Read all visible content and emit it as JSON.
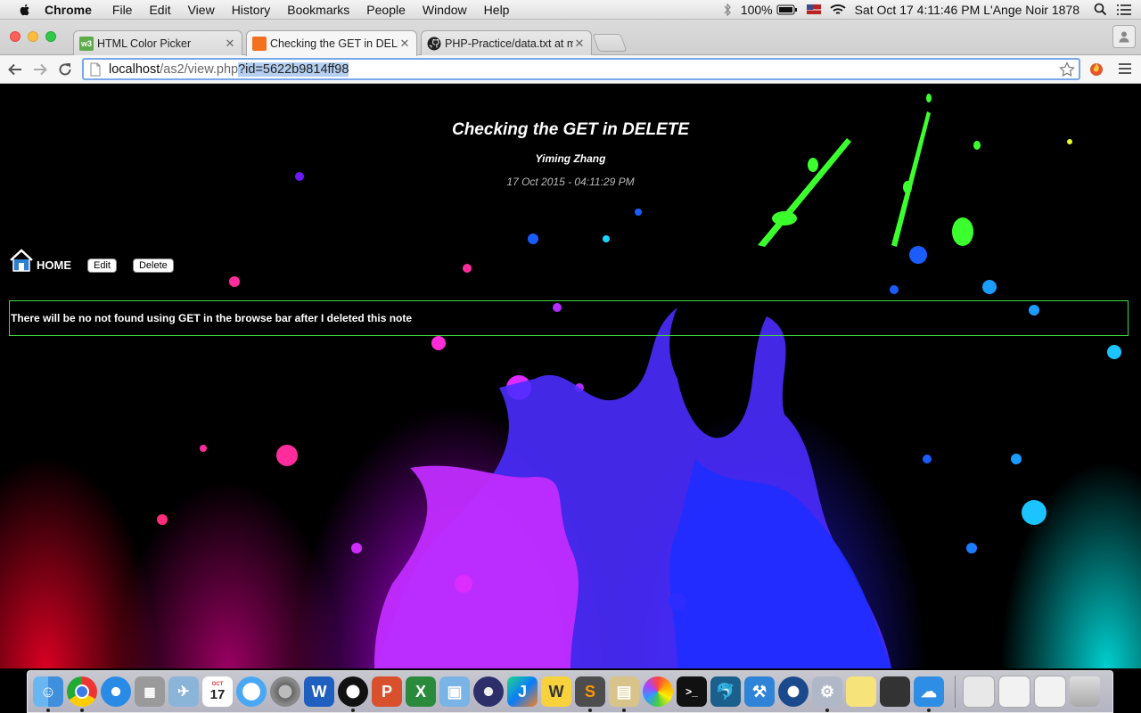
{
  "menubar": {
    "app_name": "Chrome",
    "menus": [
      "File",
      "Edit",
      "View",
      "History",
      "Bookmarks",
      "People",
      "Window",
      "Help"
    ],
    "battery_text": "100%",
    "datetime": "Sat Oct 17  4:11:46 PM",
    "user": "L'Ange Noir 1878"
  },
  "tabs": [
    {
      "title": "HTML Color Picker",
      "favicon": "w3schools-icon",
      "color": "#5dab4a"
    },
    {
      "title": "Checking the GET in DELE",
      "favicon": "xampp-icon",
      "color": "#f37021",
      "active": true
    },
    {
      "title": "PHP-Practice/data.txt at m",
      "favicon": "github-icon",
      "color": "#222222"
    }
  ],
  "address_bar": {
    "host": "localhost",
    "path": "/as2/view.php",
    "query": "?id=5622b9814ff98"
  },
  "note": {
    "title": "Checking the GET in DELETE",
    "author": "Yiming Zhang",
    "date": "17 Oct 2015 - 04:11:29 PM",
    "body": "There will be no not found using GET in the browse bar after I deleted this note"
  },
  "nav": {
    "home_label": "HOME",
    "edit_label": "Edit",
    "delete_label": "Delete"
  },
  "colors": {
    "note_border": "#3fdc3f",
    "address_selection": "#b4cff0"
  },
  "dock": {
    "apps": [
      "finder-icon",
      "chrome-icon",
      "safari-icon",
      "calculator-icon",
      "preview-icon",
      "calendar-icon",
      "messages-icon",
      "system-preferences-icon",
      "word-icon",
      "qq-icon",
      "powerpoint-icon",
      "excel-icon",
      "virtualbox-icon",
      "eclipse-icon",
      "jetbrains-icon",
      "webstorm-icon",
      "sublime-text-icon",
      "archive-icon",
      "photos-icon",
      "terminal-icon",
      "mysql-workbench-icon",
      "xcode-icon",
      "quicktime-icon",
      "utilities-icon",
      "stickies-icon",
      "printer-icon",
      "icloud-icon"
    ],
    "calendar_day": "17",
    "stacks": [
      "downloads-stack-icon",
      "documents-stack-icon",
      "applications-stack-icon",
      "trash-icon"
    ]
  }
}
